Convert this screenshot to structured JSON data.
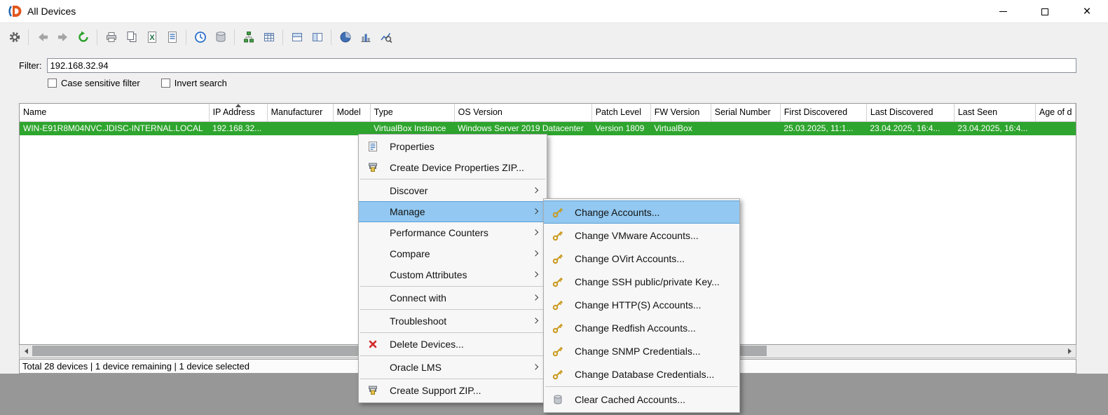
{
  "window": {
    "title": "All Devices",
    "controls": {
      "close": "×"
    }
  },
  "toolbar": {
    "buttons": [
      "settings-gear",
      "back",
      "forward",
      "refresh",
      "print",
      "copy",
      "export-excel",
      "export-report",
      "scheduler",
      "database",
      "topology",
      "table-view",
      "split-horizontal-view",
      "split-vertical-view",
      "pie-chart",
      "bar-chart",
      "chart-zoom"
    ]
  },
  "filter": {
    "label": "Filter:",
    "value": "192.168.32.94",
    "case_sensitive_label": "Case sensitive filter",
    "invert_label": "Invert search"
  },
  "table": {
    "columns": [
      {
        "label": "Name"
      },
      {
        "label": "IP Address",
        "sorted": "asc"
      },
      {
        "label": "Manufacturer"
      },
      {
        "label": "Model"
      },
      {
        "label": "Type"
      },
      {
        "label": "OS Version"
      },
      {
        "label": "Patch Level"
      },
      {
        "label": "FW Version"
      },
      {
        "label": "Serial Number"
      },
      {
        "label": "First Discovered"
      },
      {
        "label": "Last Discovered"
      },
      {
        "label": "Last Seen"
      },
      {
        "label": "Age of d"
      }
    ],
    "rows": [
      {
        "selected": true,
        "cells": [
          "WIN-E91R8M04NVC.JDISC-INTERNAL.LOCAL",
          "192.168.32...",
          "",
          "",
          "VirtualBox Instance",
          "Windows Server 2019 Datacenter",
          "Version 1809",
          "VirtualBox",
          "",
          "25.03.2025, 11:1...",
          "23.04.2025, 16:4...",
          "23.04.2025, 16:4...",
          ""
        ]
      }
    ]
  },
  "status_bar": {
    "text": "Total 28 devices | 1 device remaining | 1 device selected"
  },
  "context_menu": {
    "items": [
      {
        "label": "Properties",
        "icon": "properties-icon"
      },
      {
        "label": "Create Device Properties ZIP...",
        "icon": "zip-icon"
      },
      {
        "label": "Discover",
        "submenu": true
      },
      {
        "label": "Manage",
        "submenu": true,
        "highlighted": true
      },
      {
        "label": "Performance Counters",
        "submenu": true
      },
      {
        "label": "Compare",
        "submenu": true
      },
      {
        "label": "Custom Attributes",
        "submenu": true
      },
      {
        "label": "Connect with",
        "submenu": true
      },
      {
        "label": "Troubleshoot",
        "submenu": true
      },
      {
        "label": "Delete Devices...",
        "icon": "delete-icon"
      },
      {
        "label": "Oracle LMS",
        "submenu": true
      },
      {
        "label": "Create Support ZIP...",
        "icon": "zip-icon"
      }
    ]
  },
  "manage_submenu": {
    "items": [
      {
        "label": "Change Accounts...",
        "icon": "key-icon",
        "highlighted": true
      },
      {
        "label": "Change VMware Accounts...",
        "icon": "key-icon"
      },
      {
        "label": "Change OVirt Accounts...",
        "icon": "key-icon"
      },
      {
        "label": "Change SSH public/private Key...",
        "icon": "key-icon"
      },
      {
        "label": "Change HTTP(S) Accounts...",
        "icon": "key-icon"
      },
      {
        "label": "Change Redfish Accounts...",
        "icon": "key-icon"
      },
      {
        "label": "Change SNMP Credentials...",
        "icon": "key-icon"
      },
      {
        "label": "Change Database Credentials...",
        "icon": "key-icon"
      },
      {
        "label": "Clear Cached Accounts...",
        "icon": "clear-cache-icon"
      }
    ]
  },
  "colors": {
    "selected_row_green": "#2ea52e",
    "menu_highlight_blue": "#92c8f1",
    "toolbar_background": "#f0f0f0"
  }
}
